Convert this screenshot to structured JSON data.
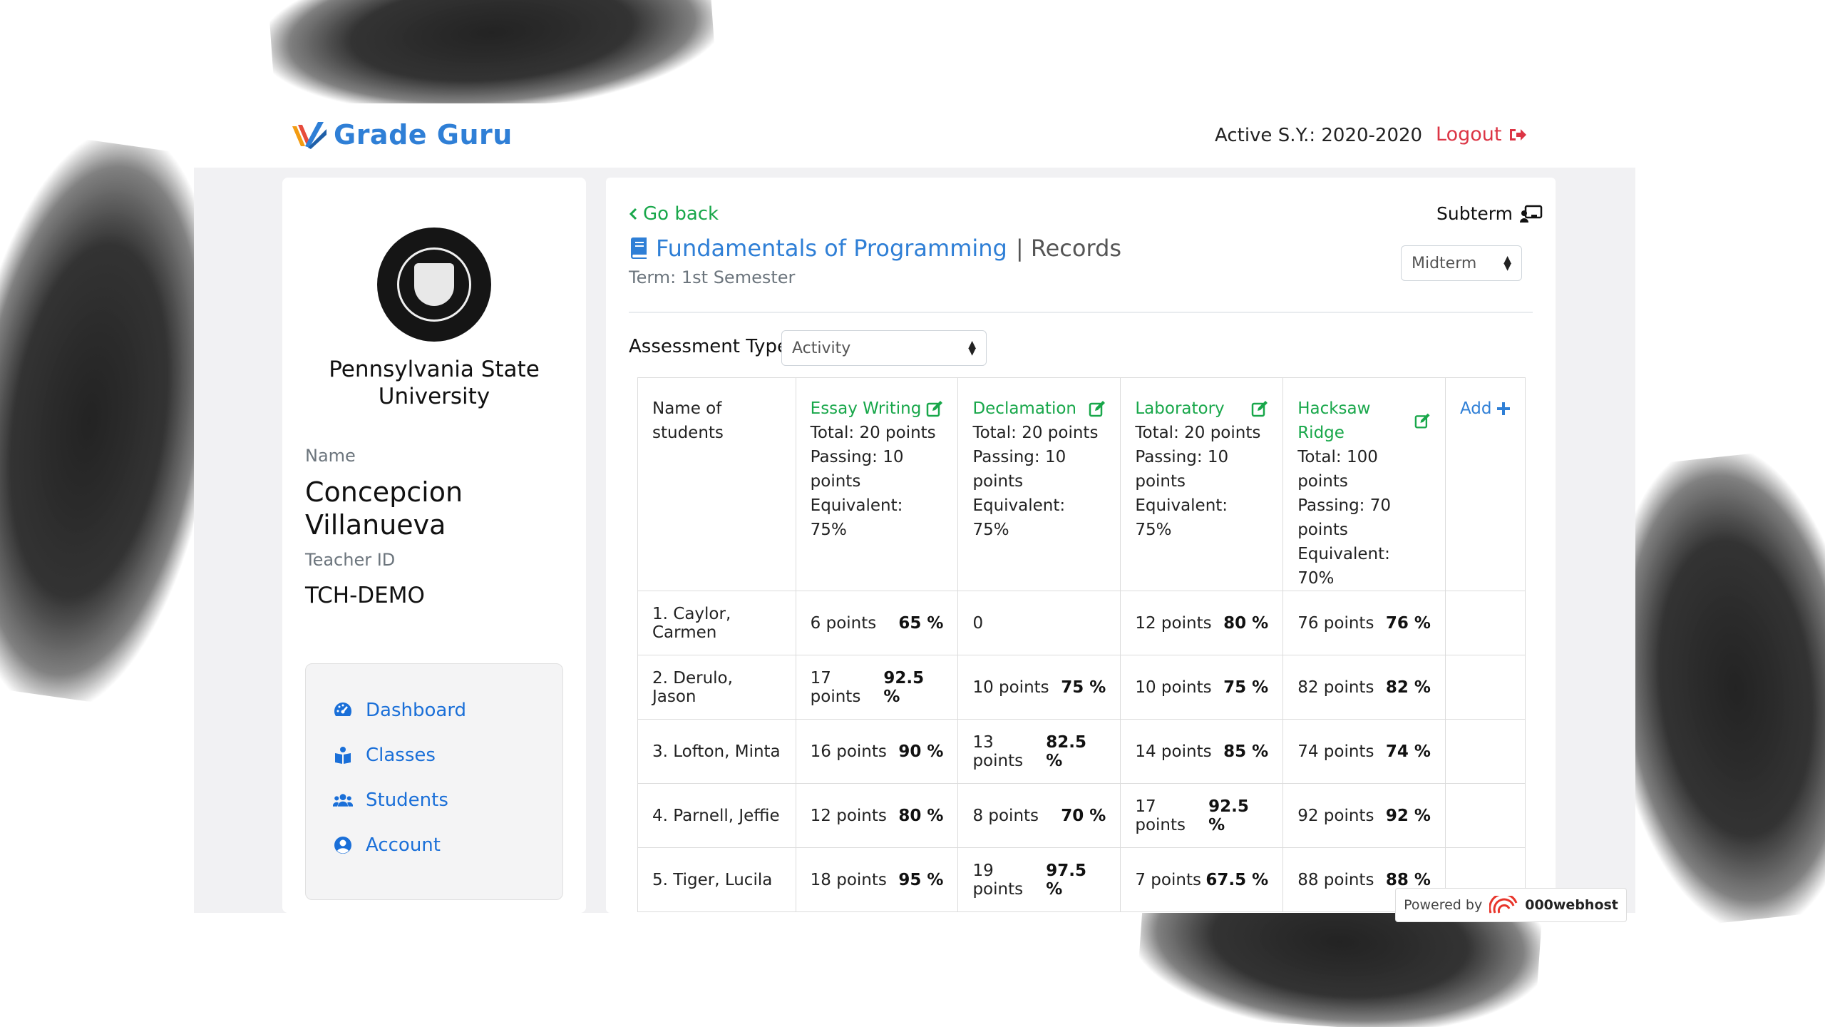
{
  "header": {
    "app_name": "Grade Guru",
    "active_sy": "Active S.Y.: 2020-2020",
    "logout_label": "Logout"
  },
  "sidebar": {
    "university": "Pennsylvania State University",
    "name_label": "Name",
    "teacher_name": "Concepcion Villanueva",
    "id_label": "Teacher ID",
    "teacher_id": "TCH-DEMO",
    "nav": [
      {
        "label": "Dashboard",
        "icon": "dashboard-icon"
      },
      {
        "label": "Classes",
        "icon": "classes-icon"
      },
      {
        "label": "Students",
        "icon": "students-icon"
      },
      {
        "label": "Account",
        "icon": "account-icon"
      }
    ]
  },
  "main": {
    "go_back": "Go back",
    "subterm_label": "Subterm",
    "subterm_value": "Midterm",
    "course": "Fundamentals of Programming",
    "records": "| Records",
    "term": "Term: 1st Semester",
    "assessment_label": "Assessment Type:",
    "assessment_value": "Activity",
    "name_header": "Name of students",
    "add_label": "Add",
    "activities": [
      {
        "name": "Essay Writing",
        "total": "Total: 20 points",
        "passing": "Passing: 10 points",
        "equivalent": "Equivalent: 75%"
      },
      {
        "name": "Declamation",
        "total": "Total: 20 points",
        "passing": "Passing: 10 points",
        "equivalent": "Equivalent: 75%"
      },
      {
        "name": "Laboratory",
        "total": "Total: 20 points",
        "passing": "Passing: 10 points",
        "equivalent": "Equivalent: 75%"
      },
      {
        "name": "Hacksaw Ridge",
        "total": "Total: 100 points",
        "passing": "Passing: 70 points",
        "equivalent": "Equivalent: 70%"
      }
    ],
    "students": [
      {
        "name": "1. Caylor, Carmen",
        "scores": [
          {
            "points": "6 points",
            "pct": "65 %"
          },
          {
            "points": "0",
            "pct": ""
          },
          {
            "points": "12 points",
            "pct": "80 %"
          },
          {
            "points": "76 points",
            "pct": "76 %"
          }
        ]
      },
      {
        "name": "2. Derulo, Jason",
        "scores": [
          {
            "points": "17 points",
            "pct": "92.5 %"
          },
          {
            "points": "10 points",
            "pct": "75 %"
          },
          {
            "points": "10 points",
            "pct": "75 %"
          },
          {
            "points": "82 points",
            "pct": "82 %"
          }
        ]
      },
      {
        "name": "3. Lofton, Minta",
        "scores": [
          {
            "points": "16 points",
            "pct": "90 %"
          },
          {
            "points": "13 points",
            "pct": "82.5 %"
          },
          {
            "points": "14 points",
            "pct": "85 %"
          },
          {
            "points": "74 points",
            "pct": "74 %"
          }
        ]
      },
      {
        "name": "4. Parnell, Jeffie",
        "scores": [
          {
            "points": "12 points",
            "pct": "80 %"
          },
          {
            "points": "8 points",
            "pct": "70 %"
          },
          {
            "points": "17 points",
            "pct": "92.5 %"
          },
          {
            "points": "92 points",
            "pct": "92 %"
          }
        ]
      },
      {
        "name": "5. Tiger, Lucila",
        "scores": [
          {
            "points": "18 points",
            "pct": "95 %"
          },
          {
            "points": "19 points",
            "pct": "97.5 %"
          },
          {
            "points": "7 points",
            "pct": "67.5 %"
          },
          {
            "points": "88 points",
            "pct": "88 %"
          }
        ]
      }
    ]
  },
  "footer": {
    "powered_by": "Powered by",
    "host": "000webhost"
  },
  "colors": {
    "brand_blue": "#2f7fd6",
    "green": "#18a74a",
    "red": "#dc3545"
  }
}
